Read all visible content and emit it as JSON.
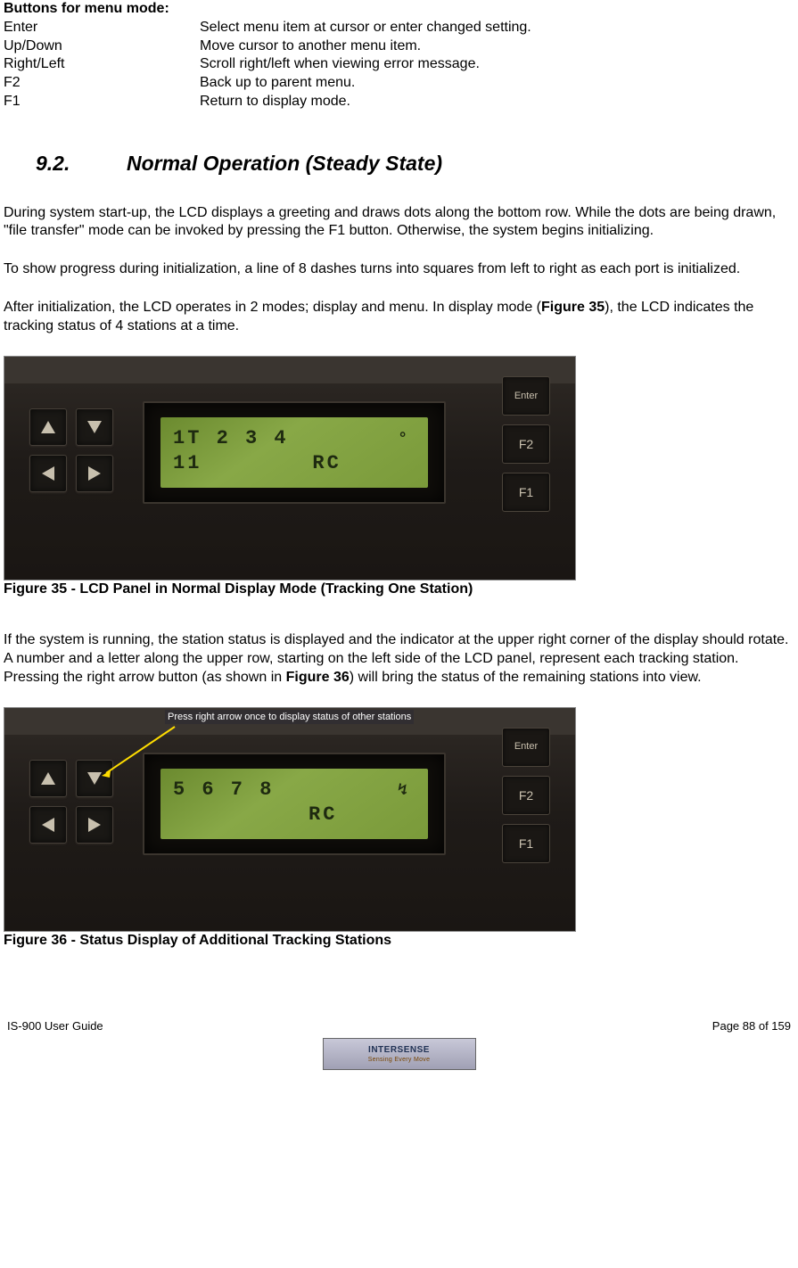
{
  "menu_mode": {
    "heading": "Buttons for menu mode:",
    "rows": [
      {
        "key": "Enter",
        "desc": "Select menu item at cursor or enter changed setting."
      },
      {
        "key": "Up/Down",
        "desc": "Move cursor to another menu item."
      },
      {
        "key": "Right/Left",
        "desc": "Scroll right/left when viewing error message."
      },
      {
        "key": "F2",
        "desc": "Back up to parent menu."
      },
      {
        "key": "F1",
        "desc": "Return to display mode."
      }
    ]
  },
  "section": {
    "number": "9.2.",
    "title": "Normal Operation (Steady State)"
  },
  "paragraphs": {
    "p1": "During system start-up, the LCD displays a greeting and draws dots along the bottom row.  While the dots are being drawn, \"file transfer\" mode can be invoked by pressing the F1 button. Otherwise, the system begins initializing.",
    "p2": "To show progress during initialization, a line of 8 dashes turns into squares from left to right as each port is initialized.",
    "p3a": "After initialization, the LCD operates in 2 modes; display and menu.  In display mode (",
    "p3ref": "Figure 35",
    "p3b": "), the LCD indicates the tracking status of 4 stations at a time.",
    "p4a": "If the system is running, the station status is displayed and the indicator at the upper right corner of the display should rotate.  A number and a letter along the upper row, starting on the left side of the LCD panel, represent each tracking station.  Pressing the right arrow button (as shown in ",
    "p4ref": "Figure 36",
    "p4b": ") will bring the status of the remaining stations into view."
  },
  "figures": {
    "f35_caption": "Figure 35 - LCD Panel in Normal Display Mode (Tracking One Station)",
    "f35_lcd_line1": "1T  2   3   4",
    "f35_lcd_line2": "11",
    "f35_lcd_rc": "RC",
    "f36_caption": "Figure 36 - Status Display of Additional Tracking Stations",
    "f36_lcd_line1": "5   6   7   8",
    "f36_lcd_rc": "RC",
    "f36_annotation": "Press right arrow once to display status of other stations"
  },
  "buttons": {
    "enter": "Enter",
    "f2": "F2",
    "f1": "F1"
  },
  "footer": {
    "left": "IS-900 User Guide",
    "right": "Page 88 of 159",
    "logo_main": "INTERSENSE",
    "logo_sub": "Sensing Every Move"
  }
}
